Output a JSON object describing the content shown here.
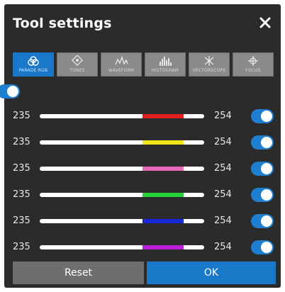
{
  "dialog": {
    "title": "Tool settings",
    "close_icon": "close-icon"
  },
  "tabs": [
    {
      "id": "tab-parade",
      "label": "PARADE RGB",
      "icon": "rgb-circles-icon",
      "active": true
    },
    {
      "id": "tab-tones",
      "label": "TONES",
      "icon": "tones-icon",
      "active": false
    },
    {
      "id": "tab-waveform",
      "label": "WAVEFORM",
      "icon": "waveform-icon",
      "active": false
    },
    {
      "id": "tab-histogram",
      "label": "HISTOGRAM",
      "icon": "histogram-icon",
      "active": false
    },
    {
      "id": "tab-vectorscope",
      "label": "VECTORSCOPE",
      "icon": "vectorscope-icon",
      "active": false
    },
    {
      "id": "tab-focus",
      "label": "FOCUS",
      "icon": "crosshair-icon",
      "active": false
    }
  ],
  "master_toggle": {
    "on": true
  },
  "ranges": [
    {
      "name": "red",
      "min": "235",
      "max": "254",
      "color": "#e02020",
      "enabled": true
    },
    {
      "name": "yellow",
      "min": "235",
      "max": "254",
      "color": "#f2e51c",
      "enabled": true
    },
    {
      "name": "pink",
      "min": "235",
      "max": "254",
      "color": "#e66ab8",
      "enabled": true
    },
    {
      "name": "green",
      "min": "235",
      "max": "254",
      "color": "#27d23c",
      "enabled": true
    },
    {
      "name": "blue",
      "min": "235",
      "max": "254",
      "color": "#1727d6",
      "enabled": true
    },
    {
      "name": "magenta",
      "min": "235",
      "max": "254",
      "color": "#b91fd8",
      "enabled": true
    }
  ],
  "buttons": {
    "reset": "Reset",
    "ok": "OK"
  },
  "colors": {
    "accent": "#1978c8",
    "panel": "#2b2b2b"
  }
}
